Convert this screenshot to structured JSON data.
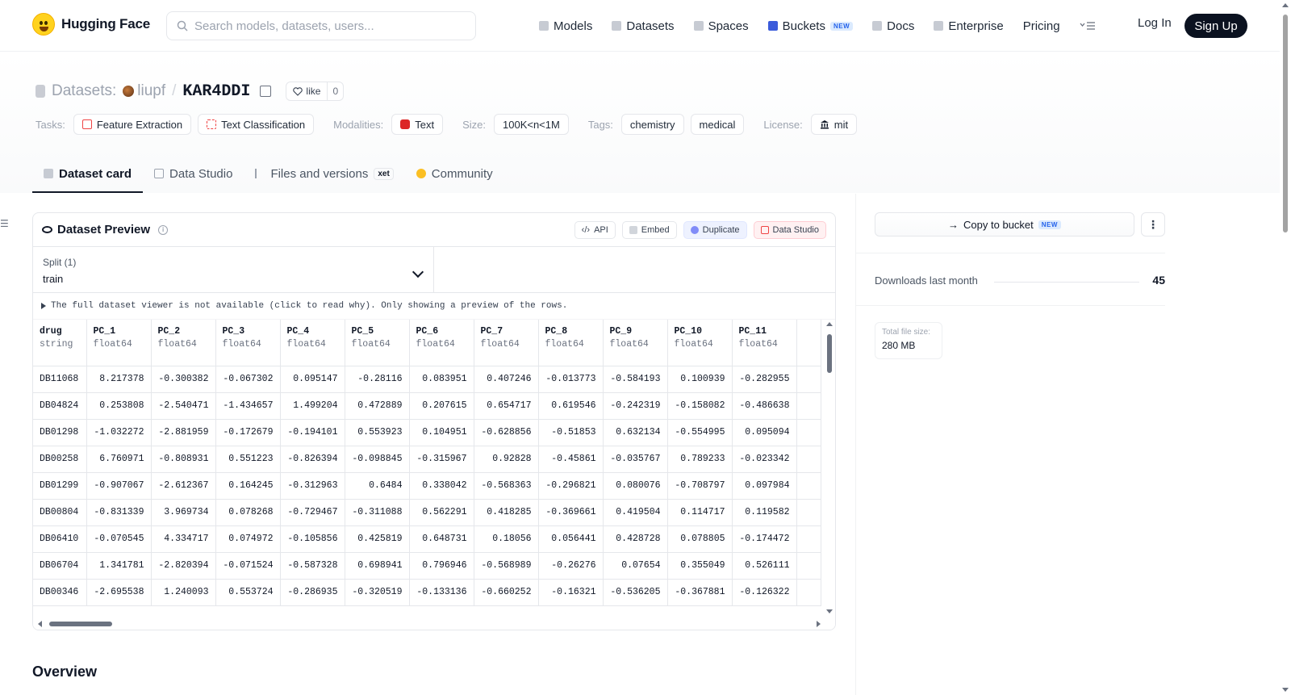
{
  "header": {
    "brand": "Hugging Face",
    "search_placeholder": "Search models, datasets, users...",
    "nav": [
      {
        "label": "Models",
        "icon": "cube-icon"
      },
      {
        "label": "Datasets",
        "icon": "database-icon"
      },
      {
        "label": "Spaces",
        "icon": "grid-icon"
      },
      {
        "label": "Buckets",
        "icon": "bucket-icon",
        "badge": "NEW"
      },
      {
        "label": "Docs",
        "icon": "book-icon"
      },
      {
        "label": "Enterprise",
        "icon": "building-icon"
      },
      {
        "label": "Pricing"
      }
    ],
    "login": "Log In",
    "signup": "Sign Up"
  },
  "repo": {
    "section": "Datasets:",
    "owner": "liupf",
    "name": "KAR4DDI",
    "like_label": "like",
    "like_count": "0"
  },
  "tags": {
    "tasks_key": "Tasks:",
    "tasks": [
      "Feature Extraction",
      "Text Classification"
    ],
    "modalities_key": "Modalities:",
    "modalities": [
      "Text"
    ],
    "size_key": "Size:",
    "size": "100K<n<1M",
    "tags_key": "Tags:",
    "tags": [
      "chemistry",
      "medical"
    ],
    "license_key": "License:",
    "license": "mit"
  },
  "tabs": [
    {
      "label": "Dataset card",
      "active": true
    },
    {
      "label": "Data Studio"
    },
    {
      "label": "Files and versions",
      "badge": "xet"
    },
    {
      "label": "Community"
    }
  ],
  "preview": {
    "title": "Dataset Preview",
    "actions": [
      "API",
      "Embed",
      "Duplicate",
      "Data Studio"
    ],
    "split_label": "Split (1)",
    "split_value": "train",
    "notice": "The full dataset viewer is not available (click to read why). Only showing a preview of the rows.",
    "columns": [
      {
        "name": "drug",
        "type": "string"
      },
      {
        "name": "PC_1",
        "type": "float64"
      },
      {
        "name": "PC_2",
        "type": "float64"
      },
      {
        "name": "PC_3",
        "type": "float64"
      },
      {
        "name": "PC_4",
        "type": "float64"
      },
      {
        "name": "PC_5",
        "type": "float64"
      },
      {
        "name": "PC_6",
        "type": "float64"
      },
      {
        "name": "PC_7",
        "type": "float64"
      },
      {
        "name": "PC_8",
        "type": "float64"
      },
      {
        "name": "PC_9",
        "type": "float64"
      },
      {
        "name": "PC_10",
        "type": "float64"
      },
      {
        "name": "PC_11",
        "type": "float64"
      }
    ],
    "rows": [
      [
        "DB11068",
        "8.217378",
        "-0.300382",
        "-0.067302",
        "0.095147",
        "-0.28116",
        "0.083951",
        "0.407246",
        "-0.013773",
        "-0.584193",
        "0.100939",
        "-0.282955"
      ],
      [
        "DB04824",
        "0.253808",
        "-2.540471",
        "-1.434657",
        "1.499204",
        "0.472889",
        "0.207615",
        "0.654717",
        "0.619546",
        "-0.242319",
        "-0.158082",
        "-0.486638"
      ],
      [
        "DB01298",
        "-1.032272",
        "-2.881959",
        "-0.172679",
        "-0.194101",
        "0.553923",
        "0.104951",
        "-0.628856",
        "-0.51853",
        "0.632134",
        "-0.554995",
        "0.095094"
      ],
      [
        "DB00258",
        "6.760971",
        "-0.808931",
        "0.551223",
        "-0.826394",
        "-0.098845",
        "-0.315967",
        "0.92828",
        "-0.45861",
        "-0.035767",
        "0.789233",
        "-0.023342"
      ],
      [
        "DB01299",
        "-0.907067",
        "-2.612367",
        "0.164245",
        "-0.312963",
        "0.6484",
        "0.338042",
        "-0.568363",
        "-0.296821",
        "0.080076",
        "-0.708797",
        "0.097984"
      ],
      [
        "DB00804",
        "-0.831339",
        "3.969734",
        "0.078268",
        "-0.729467",
        "-0.311088",
        "0.562291",
        "0.418285",
        "-0.369661",
        "0.419504",
        "0.114717",
        "0.119582"
      ],
      [
        "DB06410",
        "-0.070545",
        "4.334717",
        "0.074972",
        "-0.105856",
        "0.425819",
        "0.648731",
        "0.18056",
        "0.056441",
        "0.428728",
        "0.078805",
        "-0.174472"
      ],
      [
        "DB06704",
        "1.341781",
        "-2.820394",
        "-0.071524",
        "-0.587328",
        "0.698941",
        "0.796946",
        "-0.568989",
        "-0.26276",
        "0.07654",
        "0.355049",
        "0.526111"
      ],
      [
        "DB00346",
        "-2.695538",
        "1.240093",
        "0.553724",
        "-0.286935",
        "-0.320519",
        "-0.133136",
        "-0.660252",
        "-0.16321",
        "-0.536205",
        "-0.367881",
        "-0.126322"
      ]
    ],
    "overview_heading": "Overview"
  },
  "sidebar": {
    "copy_bucket": "Copy to bucket",
    "copy_bucket_badge": "NEW",
    "downloads_label": "Downloads last month",
    "downloads_count": "45",
    "file_size_label": "Total file size:",
    "file_size": "280 MB"
  }
}
